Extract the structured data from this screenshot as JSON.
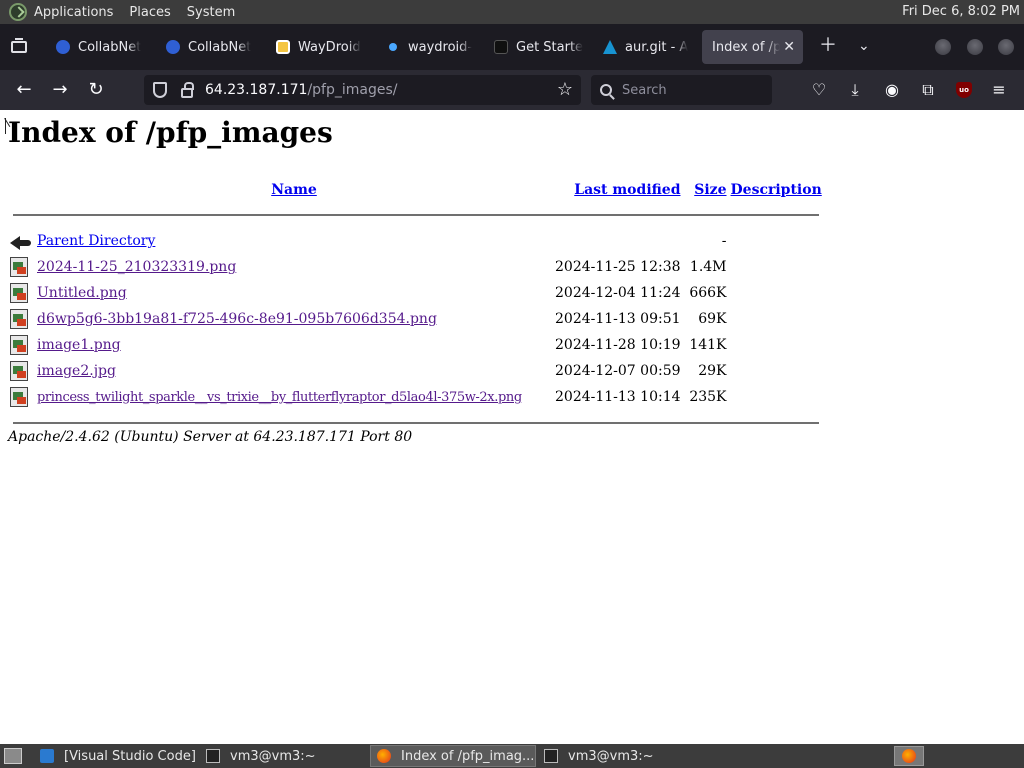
{
  "desktop": {
    "menus": [
      "Applications",
      "Places",
      "System"
    ],
    "clock": "Fri Dec  6,  8:02 PM"
  },
  "tabs": [
    {
      "title": "CollabNet",
      "icon": "collabnet-icon"
    },
    {
      "title": "CollabNet",
      "icon": "collabnet-icon"
    },
    {
      "title": "WayDroid",
      "icon": "waydroid-icon"
    },
    {
      "title": "waydroid-",
      "icon": "dot-icon"
    },
    {
      "title": "Get Starte",
      "icon": "page-icon"
    },
    {
      "title": "aur.git - A",
      "icon": "arch-icon"
    },
    {
      "title": "Index of /pf",
      "icon": "none",
      "active": true
    }
  ],
  "navbar": {
    "url_host": "64.23.187.171",
    "url_path": "/pfp_images/",
    "search_placeholder": "Search"
  },
  "page": {
    "heading": "Index of /pfp_images",
    "columns": {
      "name": "Name",
      "last_modified": "Last modified",
      "size": "Size",
      "description": "Description"
    },
    "parent": {
      "name": "Parent Directory",
      "size": "-"
    },
    "files": [
      {
        "name": "2024-11-25_210323319.png",
        "modified": "2024-11-25 12:38",
        "size": "1.4M"
      },
      {
        "name": "Untitled.png",
        "modified": "2024-12-04 11:24",
        "size": "666K"
      },
      {
        "name": "d6wp5g6-3bb19a81-f725-496c-8e91-095b7606d354.png",
        "modified": "2024-11-13 09:51",
        "size": "69K"
      },
      {
        "name": "image1.png",
        "modified": "2024-11-28 10:19",
        "size": "141K"
      },
      {
        "name": "image2.jpg",
        "modified": "2024-12-07 00:59",
        "size": "29K"
      },
      {
        "name": "princess_twilight_sparkle__vs_trixie__by_flutterflyraptor_d5lao4l-375w-2x.png",
        "modified": "2024-11-13 10:14",
        "size": "235K"
      }
    ],
    "footer": "Apache/2.4.62 (Ubuntu) Server at 64.23.187.171 Port 80"
  },
  "taskbar": [
    {
      "label": "[Visual Studio Code]",
      "icon": "vscode-icon"
    },
    {
      "label": "vm3@vm3:~",
      "icon": "terminal-icon"
    },
    {
      "label": "Index of /pfp_imag...",
      "icon": "firefox-icon",
      "active": true
    },
    {
      "label": "vm3@vm3:~",
      "icon": "terminal-icon"
    }
  ]
}
